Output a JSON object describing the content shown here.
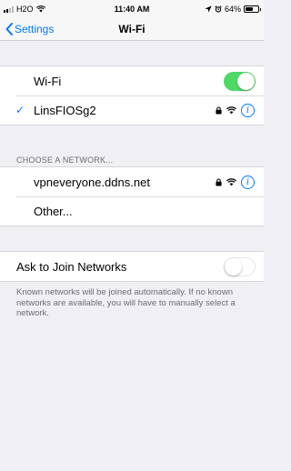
{
  "status_bar": {
    "carrier": "H2O",
    "time": "11:40 AM",
    "battery": "64%",
    "battery_level": 0.64,
    "icons": [
      "signal-bars-icon",
      "wifi-icon",
      "location-arrow-icon",
      "alarm-icon",
      "battery-icon"
    ]
  },
  "nav": {
    "back_label": "Settings",
    "title": "Wi-Fi"
  },
  "wifi": {
    "label": "Wi-Fi",
    "enabled": true,
    "connected_network": "LinsFIOSg2"
  },
  "networks": {
    "header": "CHOOSE A NETWORK...",
    "items": [
      {
        "name": "vpneveryone.ddns.net",
        "secured": true
      }
    ],
    "other_label": "Other..."
  },
  "ask_to_join": {
    "label": "Ask to Join Networks",
    "enabled": false,
    "description": "Known networks will be joined automatically. If no known networks are available, you will have to manually select a network."
  },
  "colors": {
    "accent": "#007aff",
    "toggle_on": "#4cd964",
    "background": "#efeff4"
  }
}
